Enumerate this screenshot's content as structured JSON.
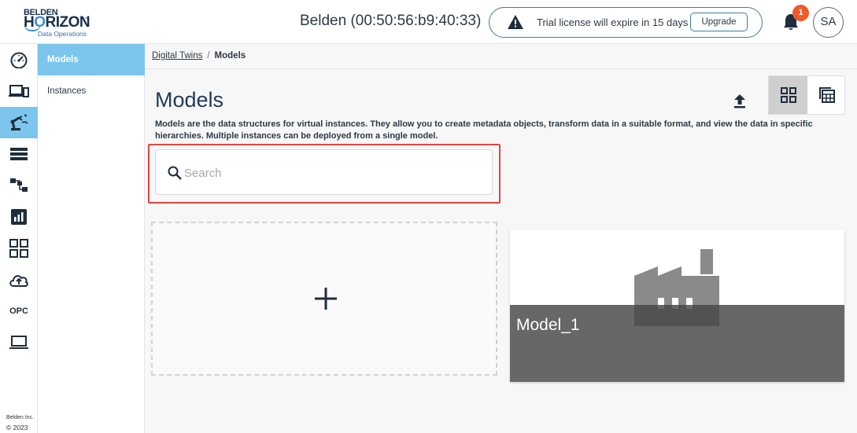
{
  "header": {
    "logo": {
      "line1": "BELDEN",
      "line2a": "H",
      "line2b": "O",
      "line2c": "RIZON",
      "tm": "™",
      "line3": "Data Operations"
    },
    "device_title": "Belden (00:50:56:b9:40:33)",
    "license_text": "Trial license will expire in 15 days",
    "upgrade_label": "Upgrade",
    "notification_count": "1",
    "avatar_initials": "SA"
  },
  "rail": {
    "items": [
      {
        "icon": "dashboard-icon"
      },
      {
        "icon": "devices-icon"
      },
      {
        "icon": "robot-arm-icon",
        "active": true
      },
      {
        "icon": "list-icon"
      },
      {
        "icon": "hierarchy-icon"
      },
      {
        "icon": "chart-icon"
      },
      {
        "icon": "apps-grid-icon"
      },
      {
        "icon": "cloud-upload-icon"
      },
      {
        "icon": "opc-icon",
        "label": "OPC"
      },
      {
        "icon": "laptop-icon"
      }
    ],
    "footer_company": "Belden Inc.",
    "footer_copyright": "© 2023"
  },
  "subnav": {
    "items": [
      {
        "label": "Models",
        "active": true
      },
      {
        "label": "Instances",
        "active": false
      }
    ]
  },
  "main": {
    "breadcrumb": {
      "parent": "Digital Twins",
      "separator": "/",
      "current": "Models"
    },
    "title": "Models",
    "description": "Models are the data structures for virtual instances. They allow you to create metadata objects, transform data in a suitable format, and view the data in specific hierarchies. Multiple instances can be deployed from a single model.",
    "search": {
      "placeholder": "Search",
      "value": ""
    },
    "add_card_icon": "plus-icon",
    "models": [
      {
        "name": "Model_1",
        "icon": "factory-icon"
      }
    ],
    "view_mode": "grid"
  },
  "colors": {
    "accent": "#7cc6ee",
    "highlight": "#e2453f",
    "badge": "#ef5a2a",
    "pill_border": "#3a7fa5"
  }
}
